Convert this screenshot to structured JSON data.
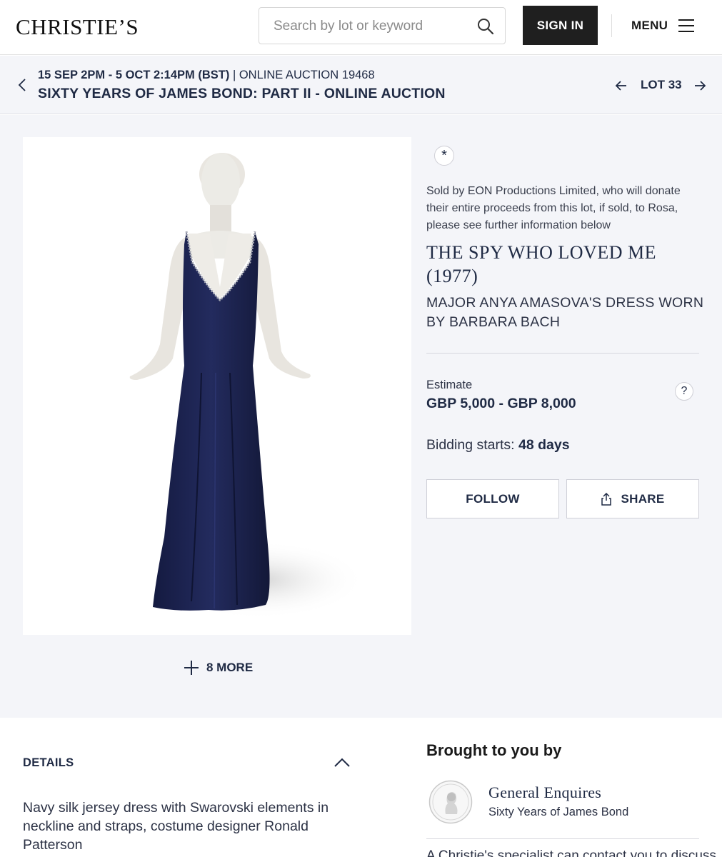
{
  "header": {
    "logo": "CHRISTIE’S",
    "search_placeholder": "Search by lot or keyword",
    "sign_in": "SIGN IN",
    "menu": "MENU"
  },
  "sale": {
    "dates": "15 SEP 2PM - 5 OCT 2:14PM (BST)",
    "separator": " | ",
    "auction_type": "ONLINE AUCTION 19468",
    "title": "SIXTY YEARS OF JAMES BOND: PART II - ONLINE AUCTION",
    "lot": "LOT 33"
  },
  "lot": {
    "badge_symbol": "*",
    "note": "Sold by EON Productions Limited, who will donate their entire proceeds from this lot, if sold, to Rosa, please see further information below",
    "title": "THE SPY WHO LOVED ME (1977)",
    "subtitle": "MAJOR ANYA AMASOVA'S DRESS WORN BY BARBARA BACH",
    "estimate_label": "Estimate",
    "estimate_value": "GBP 5,000 - GBP 8,000",
    "help_symbol": "?",
    "bidding_label": "Bidding starts: ",
    "bidding_value": "48 days",
    "follow": "FOLLOW",
    "share": "SHARE",
    "more_images": "8 MORE"
  },
  "details": {
    "heading": "DETAILS",
    "body": "Navy silk jersey dress with Swarovski elements in neckline and straps, costume designer Ronald Patterson"
  },
  "contact": {
    "heading": "Brought to you by",
    "name": "General Enquires",
    "sale": "Sixty Years of James Bond",
    "truncated_text": "A Christie's specialist can contact you to discuss"
  },
  "colors": {
    "navy_text": "#1f2a44",
    "page_tint": "#f4f5f9",
    "dress": "#1c2352",
    "button_dark": "#1f1f1f"
  }
}
